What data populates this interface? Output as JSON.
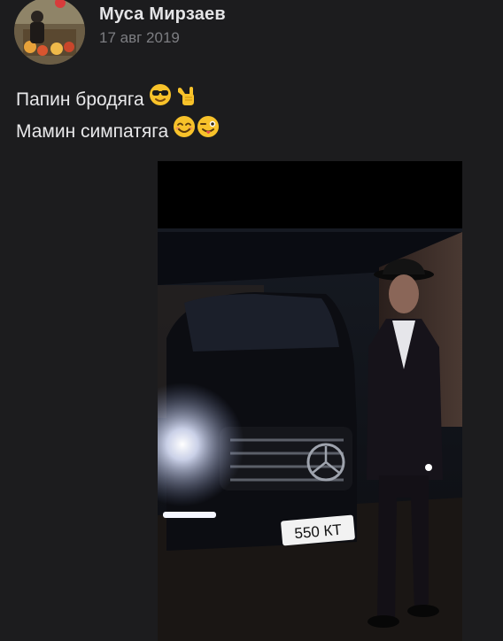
{
  "post": {
    "author": {
      "name": "Муса Мирзаев",
      "avatar_icon": "avatar-photo"
    },
    "date": "17 авг 2019",
    "text_lines": [
      {
        "text": "Папин бродяга",
        "emojis": [
          "sunglasses-face-emoji",
          "call-me-hand-emoji"
        ]
      },
      {
        "text": "Мамин симпатяга",
        "emojis": [
          "smiling-face-emoji",
          "winking-tongue-face-emoji"
        ]
      }
    ],
    "photo": {
      "plate_text": "550 КТ"
    }
  },
  "colors": {
    "background": "#1c1c1e",
    "name": "#e4e4e6",
    "date": "#7d7e82",
    "text": "#e8e8ea",
    "emoji_yellow": "#f8c22a"
  }
}
